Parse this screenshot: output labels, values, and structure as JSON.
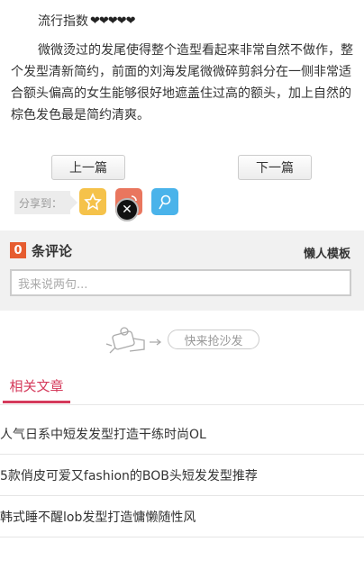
{
  "article": {
    "popularity_label": "流行指数",
    "popularity_hearts": "❤❤❤❤❤",
    "body": "微微烫过的发尾使得整个造型看起来非常自然不做作，整个发型清新简约，前面的刘海发尾微微碎剪斜分在一侧非常适合额头偏高的女生能够很好地遮盖住过高的额头，加上自然的棕色发色最是简约清爽。"
  },
  "pager": {
    "prev_label": "上一篇",
    "next_label": "下一篇"
  },
  "share": {
    "label": "分享到：",
    "icons": [
      "qzone-icon",
      "weibo-icon",
      "tencent-weibo-icon"
    ],
    "close_glyph": "✕"
  },
  "comments": {
    "count": "0",
    "count_label": "条评论",
    "template_link": "懒人模板",
    "input_placeholder": "我来说两句..."
  },
  "sofa": {
    "button_label": "快来抢沙发"
  },
  "related": {
    "tab_label": "相关文章",
    "items": [
      "人气日系中短发发型打造干练时尚OL",
      "5款俏皮可爱又fashion的BOB头短发发型推荐",
      "韩式睡不醒lob发型打造慵懒随性风"
    ]
  },
  "colors": {
    "accent": "#d53a5b",
    "badge": "#e65c2f"
  }
}
